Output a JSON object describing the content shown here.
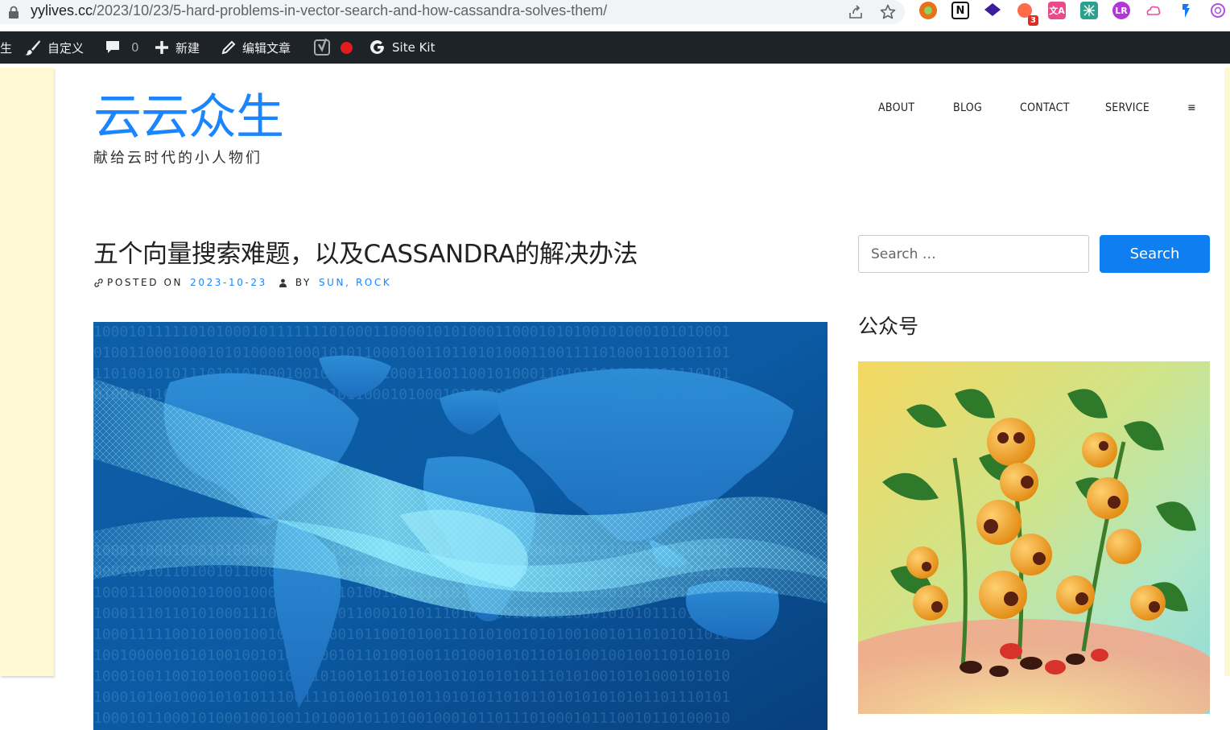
{
  "browser": {
    "url_host": "yylives.cc",
    "url_path": "/2023/10/23/5-hard-problems-in-vector-search-and-how-cassandra-solves-them/",
    "extension_badge": "3"
  },
  "adminbar": {
    "site_partial": "生",
    "customize": "自定义",
    "comments_count": "0",
    "new": "新建",
    "edit_post": "编辑文章",
    "sitekit": "Site Kit"
  },
  "site": {
    "title": "云云众生",
    "tagline": "献给云时代的小人物们"
  },
  "nav": {
    "items": [
      "ABOUT",
      "BLOG",
      "CONTACT",
      "SERVICE"
    ],
    "menu_toggle": "≡"
  },
  "post": {
    "title": "五个向量搜索难题，以及CASSANDRA的解决办法",
    "posted_on_label": "POSTED ON",
    "date": "2023-10-23",
    "by_label": "BY",
    "author": "SUN, ROCK"
  },
  "sidebar": {
    "search_placeholder": "Search …",
    "search_button": "Search",
    "widget_title": "公众号"
  },
  "colors": {
    "brand": "#1a85ff",
    "button": "#0e7ef0",
    "adminbar": "#1d2327",
    "side_panel": "#fef9d2"
  }
}
